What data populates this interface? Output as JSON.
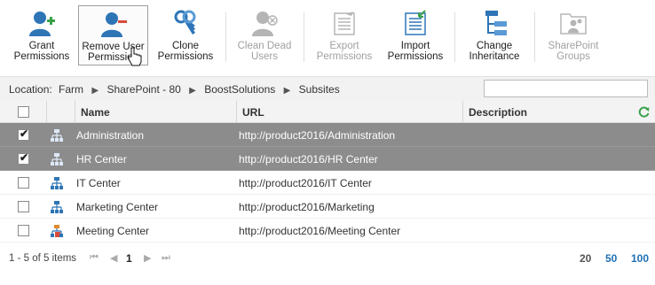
{
  "toolbar": {
    "buttons": [
      {
        "label": "Grant\nPermissions",
        "icon": "grant-permissions-icon",
        "enabled": true
      },
      {
        "label": "Remove User\nPermission",
        "icon": "remove-user-icon",
        "enabled": true,
        "selected": true
      },
      {
        "label": "Clone\nPermissions",
        "icon": "clone-permissions-icon",
        "enabled": true
      },
      {
        "label": "Clean Dead\nUsers",
        "icon": "clean-dead-users-icon",
        "enabled": false
      },
      {
        "label": "Export\nPermissions",
        "icon": "export-permissions-icon",
        "enabled": false
      },
      {
        "label": "Import\nPermissions",
        "icon": "import-permissions-icon",
        "enabled": true
      },
      {
        "label": "Change\nInheritance",
        "icon": "change-inheritance-icon",
        "enabled": true
      },
      {
        "label": "SharePoint\nGroups",
        "icon": "sharepoint-groups-icon",
        "enabled": false
      }
    ]
  },
  "location": {
    "prefix": "Location:",
    "crumbs": [
      "Farm",
      "SharePoint - 80",
      "BoostSolutions",
      "Subsites"
    ],
    "search_value": ""
  },
  "grid": {
    "columns": {
      "name": "Name",
      "url": "URL",
      "description": "Description"
    },
    "rows": [
      {
        "name": "Administration",
        "url": "http://product2016/Administration",
        "description": "",
        "checked": true,
        "selected": true,
        "icon": "site-icon"
      },
      {
        "name": "HR Center",
        "url": "http://product2016/HR Center",
        "description": "",
        "checked": true,
        "selected": true,
        "icon": "site-icon"
      },
      {
        "name": "IT Center",
        "url": "http://product2016/IT Center",
        "description": "",
        "checked": false,
        "selected": false,
        "icon": "site-icon"
      },
      {
        "name": "Marketing Center",
        "url": "http://product2016/Marketing",
        "description": "",
        "checked": false,
        "selected": false,
        "icon": "site-icon"
      },
      {
        "name": "Meeting Center",
        "url": "http://product2016/Meeting Center",
        "description": "",
        "checked": false,
        "selected": false,
        "icon": "meeting-site-icon"
      }
    ]
  },
  "footer": {
    "info": "1 - 5 of 5 items",
    "current_page": "1",
    "page_sizes": [
      "20",
      "50",
      "100"
    ],
    "active_page_size": "20"
  },
  "colors": {
    "accent": "#1f6fb5",
    "selected_row": "#8c8c8c",
    "grant_green": "#3aa14a",
    "remove_red": "#d94b3b"
  }
}
